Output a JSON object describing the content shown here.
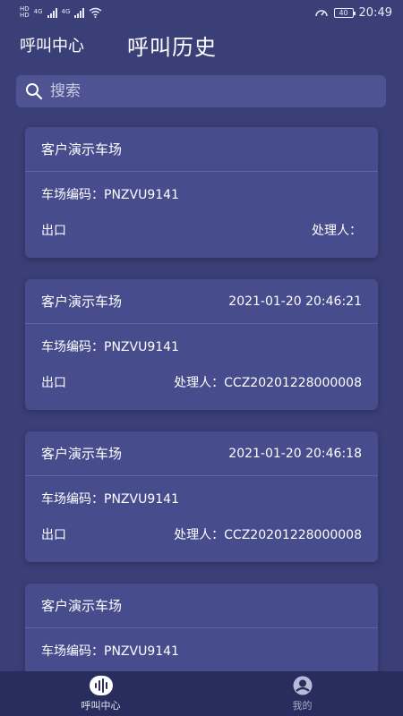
{
  "status_bar": {
    "sim1": "HD",
    "sim2": "HD",
    "net1": "4G",
    "net2": "4G",
    "battery": "40",
    "time": "20:49"
  },
  "header": {
    "app_name": "呼叫中心",
    "title": "呼叫历史"
  },
  "search": {
    "placeholder": "搜索",
    "value": ""
  },
  "cards": [
    {
      "name": "客户演示车场",
      "time": "",
      "code_label": "车场编码：",
      "code": "PNZVU9141",
      "direction": "出口",
      "handler_label": "处理人：",
      "handler": ""
    },
    {
      "name": "客户演示车场",
      "time": "2021-01-20 20:46:21",
      "code_label": "车场编码：",
      "code": "PNZVU9141",
      "direction": "出口",
      "handler_label": "处理人：",
      "handler": "CCZ20201228000008"
    },
    {
      "name": "客户演示车场",
      "time": "2021-01-20 20:46:18",
      "code_label": "车场编码：",
      "code": "PNZVU9141",
      "direction": "出口",
      "handler_label": "处理人：",
      "handler": "CCZ20201228000008"
    },
    {
      "name": "客户演示车场",
      "time": "",
      "code_label": "车场编码：",
      "code": "PNZVU9141",
      "direction": "",
      "handler_label": "",
      "handler": ""
    }
  ],
  "tabbar": {
    "tabs": [
      {
        "label": "呼叫中心",
        "icon": "voice-wave-icon"
      },
      {
        "label": "我的",
        "icon": "user-avatar-icon"
      }
    ]
  },
  "colors": {
    "background": "#3a3f78",
    "card": "#464c8c",
    "tabbar": "#292d5e",
    "search": "#4e5492"
  }
}
